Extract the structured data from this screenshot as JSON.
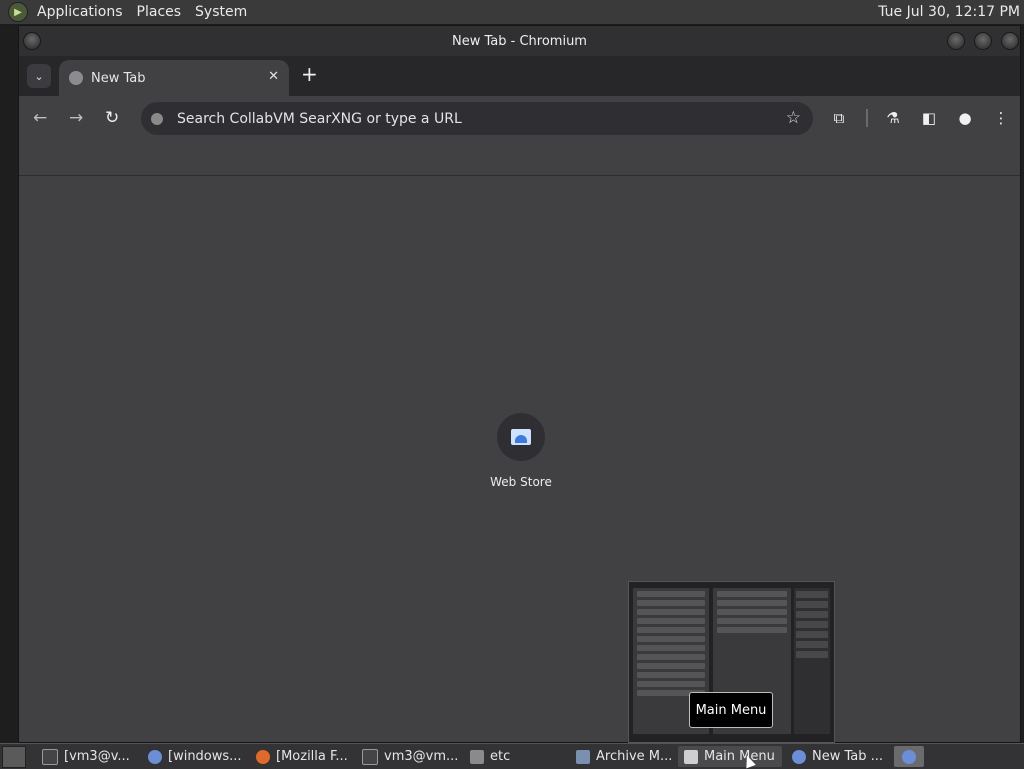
{
  "top_panel": {
    "menus": [
      "Applications",
      "Places",
      "System"
    ],
    "clock": "Tue Jul 30, 12:17 PM"
  },
  "window": {
    "title": "New Tab - Chromium",
    "tab": {
      "title": "New Tab",
      "close": "✕"
    },
    "new_tab": "+",
    "omnibox": {
      "placeholder": "Search CollabVM SearXNG or type a URL"
    }
  },
  "content": {
    "shortcut": {
      "label": "Web Store"
    }
  },
  "tooltip": "Main Menu",
  "taskbar": {
    "tasks": [
      {
        "label": "[vm3@v...",
        "icon": "terminal-icon"
      },
      {
        "label": "[windows...",
        "icon": "chromium-icon"
      },
      {
        "label": "[Mozilla F...",
        "icon": "firefox-icon"
      },
      {
        "label": "vm3@vm...",
        "icon": "terminal-icon"
      },
      {
        "label": "etc",
        "icon": "folder-icon"
      },
      {
        "label": "Archive M...",
        "icon": "archive-icon"
      },
      {
        "label": "Main Menu",
        "icon": "editor-icon"
      },
      {
        "label": "New Tab ...",
        "icon": "chromium-icon"
      }
    ]
  }
}
